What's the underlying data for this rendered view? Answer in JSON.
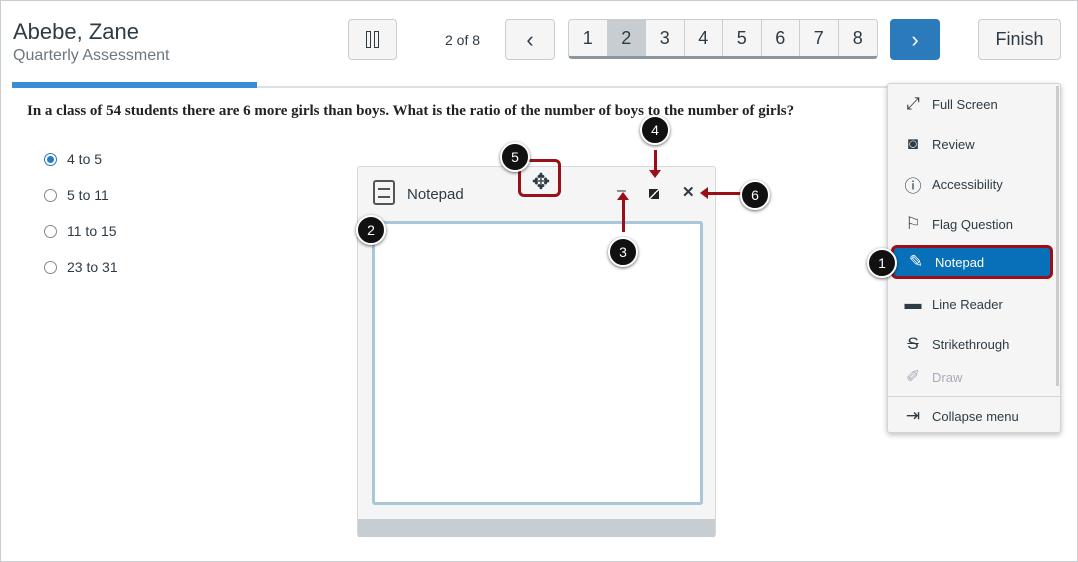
{
  "header": {
    "student_name": "Abebe, Zane",
    "quiz_title": "Quarterly Assessment",
    "position": "2 of 8",
    "finish_label": "Finish",
    "progress_percent": 25
  },
  "pagination": {
    "pages": [
      "1",
      "2",
      "3",
      "4",
      "5",
      "6",
      "7",
      "8"
    ],
    "current": "2"
  },
  "question": {
    "text": "In a class of 54 students there are 6 more girls than boys. What is the ratio of the number of boys to the number of girls?",
    "options": [
      "4 to 5",
      "5 to 11",
      "11 to 15",
      "23 to 31"
    ],
    "selected": "4 to 5"
  },
  "notepad": {
    "title": "Notepad",
    "content": ""
  },
  "menu": {
    "items": [
      "Full Screen",
      "Review",
      "Accessibility",
      "Flag Question",
      "Notepad",
      "Line Reader",
      "Strikethrough",
      "Draw"
    ],
    "collapse": "Collapse menu",
    "active": "Notepad"
  },
  "callouts": [
    "1",
    "2",
    "3",
    "4",
    "5",
    "6"
  ],
  "colors": {
    "accent": "#2b7abc",
    "menu_active": "#0770b8",
    "callout_border": "#9b0f18"
  }
}
